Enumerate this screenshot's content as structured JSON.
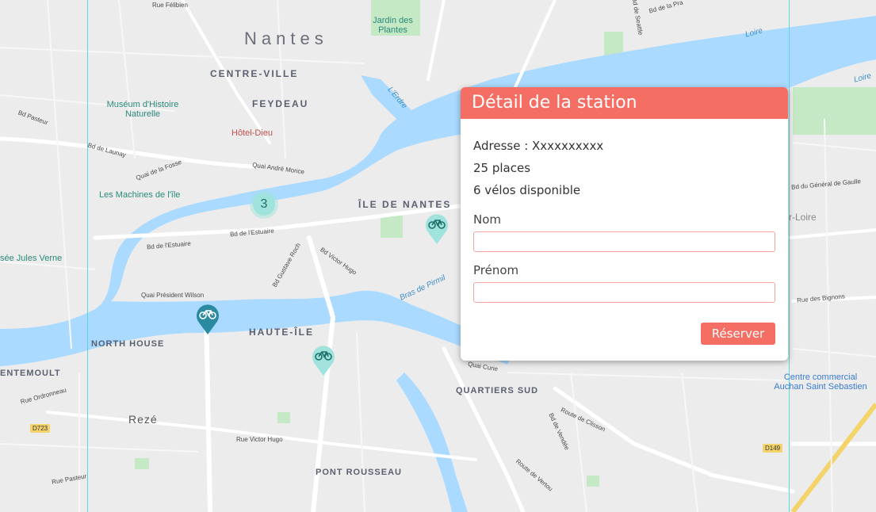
{
  "map": {
    "city": "Nantes",
    "districts": [
      "CENTRE-VILLE",
      "FEYDEAU",
      "ÎLE DE NANTES",
      "HAUTE-ÎLE",
      "NORTH HOUSE",
      "QUARTIERS SUD",
      "PONT ROUSSEAU",
      "ENTEMOULT"
    ],
    "places": [
      "Rezé",
      "Jardin des Plantes",
      "Muséum d'Histoire Naturelle",
      "Hôtel-Dieu",
      "Les Machines de l'île",
      "sée Jules Verne",
      "Centre commercial Auchan Saint Sebastien",
      "r-Loire"
    ],
    "streets": [
      "Rue Félibien",
      "Bd Pasteur",
      "Bd de Launay",
      "Quai de la Fosse",
      "Quai André Morice",
      "Bd de l'Estuaire",
      "Bd de l'Estuaire",
      "Quai Président Wilson",
      "Bd Gustave Roch",
      "Bd Victor Hugo",
      "Rue Victor Hugo",
      "Rue Ordronneau",
      "Rue Pasteur",
      "Route de Clisson",
      "Bd de Vendée",
      "Route de Vertou",
      "Bd du Général de Gaulle",
      "Rue des Bignons",
      "Bd de la Pra",
      "Bd de Seattle",
      "Quai Curie"
    ],
    "water": [
      "Loire",
      "Loire",
      "L'Erdre",
      "Bras de Pirmil"
    ],
    "roads": [
      "D723",
      "D149"
    ],
    "cluster_count": "3",
    "colors": {
      "river": "#aadaff",
      "park": "#c5e8c5",
      "marker_dark": "#2a8aa0",
      "marker_light": "#9fe3dc",
      "accent": "#f46e63"
    }
  },
  "panel": {
    "title": "Détail de la station",
    "address": "Adresse : Xxxxxxxxxx",
    "places": "25 places",
    "bikes": "6 vélos disponible",
    "nom_label": "Nom",
    "prenom_label": "Prénom",
    "nom_value": "",
    "prenom_value": "",
    "submit_label": "Réserver"
  }
}
